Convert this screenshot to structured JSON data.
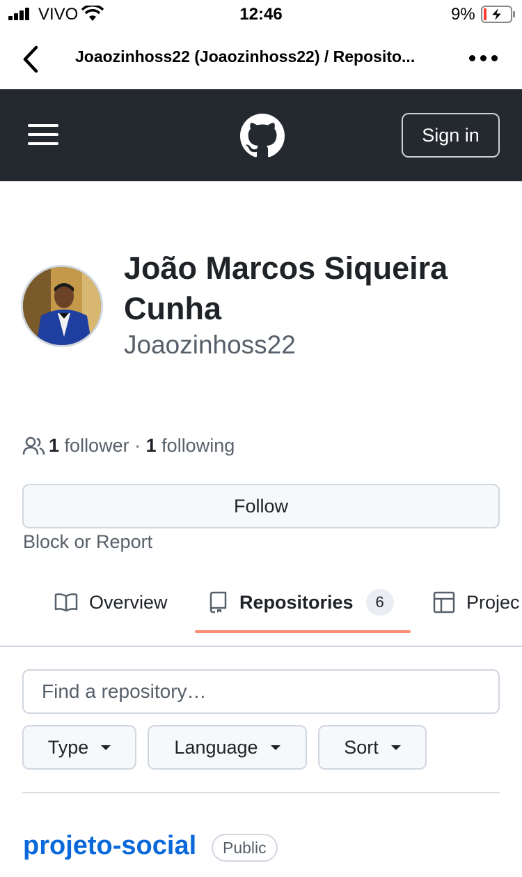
{
  "status_bar": {
    "carrier": "VIVO",
    "time": "12:46",
    "battery_percent": "9%"
  },
  "nav_bar": {
    "title": "Joaozinhoss22 (Joaozinhoss22) / Reposito...",
    "back_icon": "chevron-left-icon",
    "more_icon": "ellipsis-icon"
  },
  "header": {
    "menu_icon": "hamburger-icon",
    "logo_icon": "github-logo-icon",
    "sign_in_label": "Sign in"
  },
  "profile": {
    "full_name": "João Marcos Siqueira Cunha",
    "username": "Joaozinhoss22",
    "followers_count": "1",
    "followers_label": "follower",
    "separator": "·",
    "following_count": "1",
    "following_label": "following",
    "follow_button": "Follow",
    "block_link": "Block or Report"
  },
  "tabs": [
    {
      "label": "Overview",
      "icon": "book-icon"
    },
    {
      "label": "Repositories",
      "icon": "repo-icon",
      "count": "6",
      "active": true
    },
    {
      "label": "Projec",
      "icon": "table-icon"
    }
  ],
  "repo_search": {
    "placeholder": "Find a repository…",
    "filters": [
      "Type",
      "Language",
      "Sort"
    ]
  },
  "repositories": [
    {
      "name": "projeto-social",
      "visibility": "Public"
    }
  ],
  "colors": {
    "header_bg": "#24292f",
    "link": "#0969da",
    "tab_underline": "#fd8c73",
    "muted": "#57606a"
  }
}
